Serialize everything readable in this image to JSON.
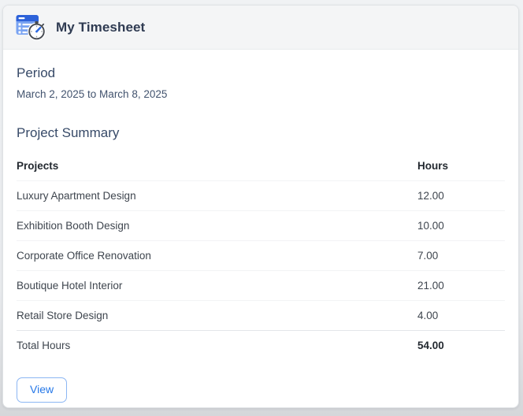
{
  "header": {
    "title": "My Timesheet",
    "icon": "timesheet-stopwatch-icon"
  },
  "period": {
    "heading": "Period",
    "range": "March 2, 2025 to March 8, 2025"
  },
  "summary": {
    "heading": "Project Summary",
    "table": {
      "columns": [
        "Projects",
        "Hours"
      ],
      "rows": [
        {
          "project": "Luxury Apartment Design",
          "hours": "12.00"
        },
        {
          "project": "Exhibition Booth Design",
          "hours": "10.00"
        },
        {
          "project": "Corporate Office Renovation",
          "hours": "7.00"
        },
        {
          "project": "Boutique Hotel Interior",
          "hours": "21.00"
        },
        {
          "project": "Retail Store Design",
          "hours": "4.00"
        }
      ],
      "total": {
        "label": "Total Hours",
        "hours": "54.00"
      }
    }
  },
  "actions": {
    "view_label": "View"
  },
  "colors": {
    "accent_blue": "#2678e8",
    "button_border_blue": "#8cb6f3",
    "icon_body_blue": "#79a3f2",
    "icon_header_blue": "#2d62d9",
    "heading_navy": "#374a68",
    "title_navy": "#2f3b52",
    "page_background": "#e9ebee"
  }
}
